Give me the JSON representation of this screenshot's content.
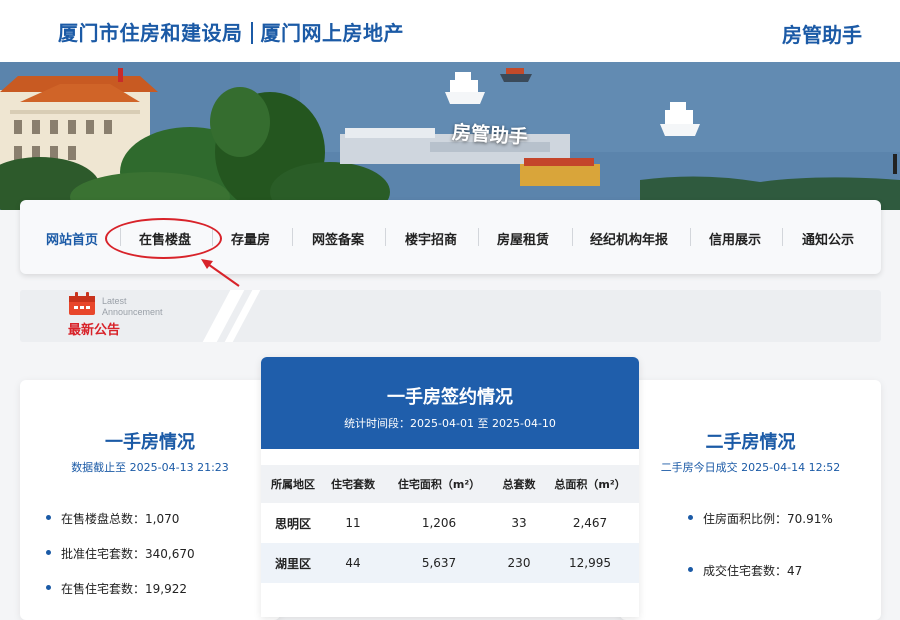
{
  "header": {
    "site_title_part1": "厦门市住房和建设局",
    "site_title_part2": "厦门网上房地产",
    "helper_title": "房管助手"
  },
  "banner": {
    "overlay_text": "房管助手"
  },
  "nav": {
    "items": [
      {
        "label": "网站首页",
        "active": true
      },
      {
        "label": "在售楼盘"
      },
      {
        "label": "存量房"
      },
      {
        "label": "网签备案"
      },
      {
        "label": "楼宇招商"
      },
      {
        "label": "房屋租赁"
      },
      {
        "label": "经纪机构年报"
      },
      {
        "label": "信用展示"
      },
      {
        "label": "通知公示"
      }
    ]
  },
  "announcement": {
    "en_line1": "Latest",
    "en_line2": "Announcement",
    "cn_label": "最新公告"
  },
  "left_card": {
    "title": "一手房情况",
    "subtitle": "数据截止至 2025-04-13 21:23",
    "stats": [
      "在售楼盘总数：1,070",
      "批准住宅套数：340,670",
      "在售住宅套数：19,922"
    ]
  },
  "center_card": {
    "title": "一手房签约情况",
    "period": "统计时间段：2025-04-01 至 2025-04-10",
    "columns": [
      "所属地区",
      "住宅套数",
      "住宅面积（m²）",
      "总套数",
      "总面积（m²）"
    ],
    "rows": [
      [
        "思明区",
        "11",
        "1,206",
        "33",
        "2,467"
      ],
      [
        "湖里区",
        "44",
        "5,637",
        "230",
        "12,995"
      ]
    ]
  },
  "right_card": {
    "title": "二手房情况",
    "subtitle": "二手房今日成交 2025-04-14 12:52",
    "stats": [
      "住房面积比例：70.91%",
      "成交住宅套数：47"
    ]
  },
  "colors": {
    "brand_blue": "#1b5aa6",
    "table_head_blue": "#1f5eab",
    "annotation_red": "#d8232a"
  }
}
